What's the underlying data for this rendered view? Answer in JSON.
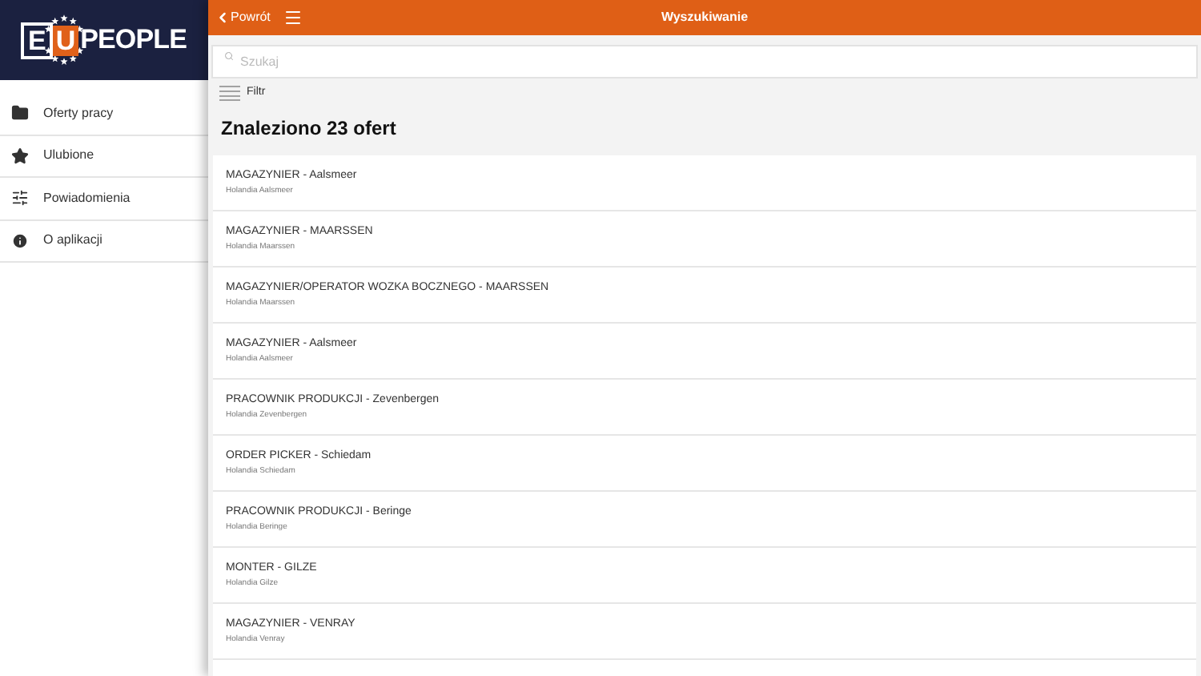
{
  "logo": {
    "boxed_letters": [
      "E",
      "U"
    ],
    "text": "PEOPLE"
  },
  "sidebar": {
    "items": [
      {
        "kind": "folder",
        "label": "Oferty pracy"
      },
      {
        "kind": "star",
        "label": "Ulubione"
      },
      {
        "kind": "sliders",
        "label": "Powiadomienia"
      },
      {
        "kind": "info",
        "label": "O aplikacji"
      }
    ]
  },
  "header": {
    "back": "Powrót",
    "title": "Wyszukiwanie"
  },
  "search": {
    "placeholder": "Szukaj"
  },
  "filter": {
    "label": "Filtr"
  },
  "results_heading": "Znaleziono 23 ofert",
  "offers": [
    {
      "title": "MAGAZYNIER - Aalsmeer",
      "location": "Holandia Aalsmeer"
    },
    {
      "title": "MAGAZYNIER - MAARSSEN",
      "location": "Holandia Maarssen"
    },
    {
      "title": "MAGAZYNIER/OPERATOR WOZKA BOCZNEGO - MAARSSEN",
      "location": "Holandia Maarssen"
    },
    {
      "title": "MAGAZYNIER - Aalsmeer",
      "location": "Holandia Aalsmeer"
    },
    {
      "title": "PRACOWNIK PRODUKCJI - Zevenbergen",
      "location": "Holandia Zevenbergen"
    },
    {
      "title": "ORDER PICKER - Schiedam",
      "location": "Holandia Schiedam"
    },
    {
      "title": "PRACOWNIK PRODUKCJI - Beringe",
      "location": "Holandia Beringe"
    },
    {
      "title": "MONTER - GILZE",
      "location": "Holandia Gilze"
    },
    {
      "title": "MAGAZYNIER - VENRAY",
      "location": "Holandia Venray"
    }
  ]
}
